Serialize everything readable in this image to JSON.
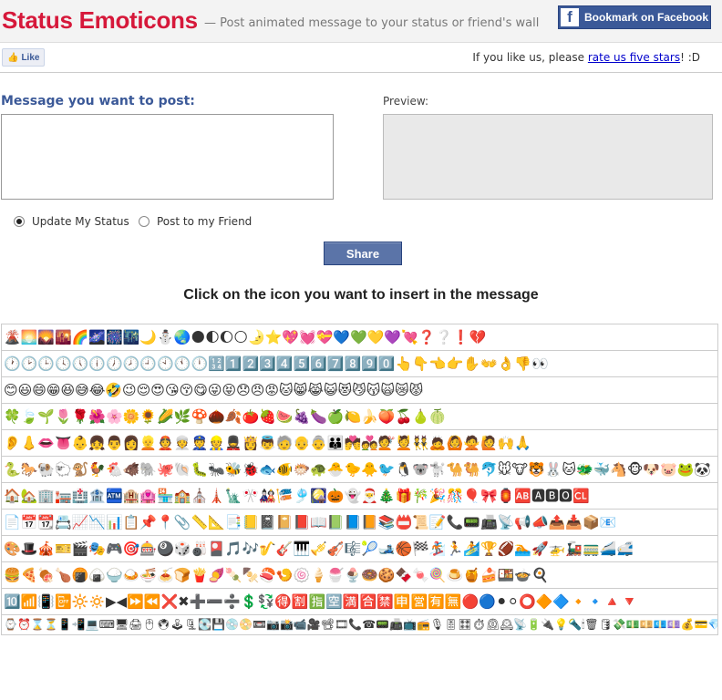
{
  "header": {
    "title": "Status Emoticons",
    "subtitle": "— Post animated message to your status or friend's wall",
    "bookmark_label": "Bookmark on Facebook",
    "fb_logo": "f"
  },
  "likebar": {
    "like_label": "Like",
    "like_icon": "👍",
    "rate_prefix": "If you like us, please ",
    "rate_link": "rate us five stars",
    "rate_suffix": "! :D"
  },
  "form": {
    "message_label": "Message you want to post:",
    "preview_label": "Preview:",
    "message_value": "",
    "option_update": "Update My Status",
    "option_friend": "Post to my Friend",
    "selected_option": "Update My Status",
    "share_label": "Share"
  },
  "instructions": "Click on the icon you want to insert in the message",
  "emoticon_rows": [
    "🌋🌅🌄🌇🌈🌌🎆🌃🌙⛄🌏🌑🌓🌔🌕🌛⭐💖💓💝💙💚💛💜💘❓❔❗💔",
    "🕐🕑🕒🕓🕔🕕🕖🕗🕘🕙🕚🕛🔢1️⃣2️⃣3️⃣4️⃣5️⃣6️⃣7️⃣8️⃣9️⃣0️⃣👆👇👈👉✋👐👌👎👀",
    "😊😃😄😁😆😅😂🤣😉😌😍😘😚😋😜😝😞😠😡🐱😸😹😺😻😼😽🙀😿😾",
    "🍀🍃🌱🌷🌹🌺🌸🌼🌻🌽🌿🍄🌰🍂🍅🍓🍉🍇🍆🍏🍋🍌🍑🍒🍐🍈",
    "👂👃👄👅👶👧👨👩👱👲👳👮👷💂👸👼🧓👴👵👪💏💑💇💆👯🙇🙆🙅🙋🙌🙏",
    "🐍🐎🐏🐑🐒🐓🐔🐗🐘🐙🐚🐛🐜🐝🐞🐟🐠🐡🐢🐣🐤🐥🐦🐧🐨🐩🐪🐫🐬🐭🐮🐯🐰🐱🐲🐳🐴🐵🐶🐷🐸🐼",
    "🏠🏡🏢🏣🏥🏦🏧🏨🏩🏪🏫⛪🗼🗽🎌🎎🎏🎐🎑🎃👻🎅🎄🎁🎋🎉🎊🎈🎀🏮🆎🅰🅱🅾🆑",
    "📄📅📆📇📈📉📊📋📌📍📎📏📐📑📒📓📔📕📖📗📘📙📚📛📜📝📞📟📠📡📢📣📤📥📦📧",
    "🎨🎩🎪🎫🎬🎭🎮🎯🎰🎱🎲🎳🎴🎵🎶🎷🎸🎹🎺🎻🎼🎾🎿🏀🏁🏂🏃🏄🏆🏈🏊🚀🚁🚂🚃🚄🚅",
    "🍔🍕🍖🍗🍘🍙🍚🍛🍜🍝🍞🍟🍠🍡🍢🍣🍤🍥🍦🍧🍨🍩🍪🍫🍬🍭🍮🍯🍰🍱🍲🍳",
    "🔟📶📳📴🔆🔅▶◀⏩⏪❌✖➕➖➗💲💱🉐🈹🈯🈳🈵🈴🈲🈸🈺🈶🈚🔴🔵⚫⚪⭕🔶🔷🔸🔹🔺🔻",
    "⌚⏰⌛⏳📱📲💻⌨🖥🖨🖱🖲🕹🗜💽💾💿📀📼📷📸📹🎥📽🎞📞☎📟📠📺📻🎙🎚🎛⏱⏲🕰📡🔋🔌💡🔦🕯🗑🛢💸💵💴💶💷💰💳💎⚖🔧🔨⚒🛠⛏🔩⚙⛓🔫💣🔪🗡⚔🛡🚬⚰⚱🏺🔮📿💈⚗🔭🔬🕳💊💉🌡🚽🚰🚿🛁🛀🛎🔑🗝🚪🛋🛏🛌🖼🛍🛒🎁🎈🎏🎀🎊🎉🎎🏮🎐✉📩📨📧💌📥📤📦🏷📪📫📬📭📮📯📜📃📄📑📊📈📉🗒🗓📆📅📇🗃🗳🗄📋📁📂🗂🗞📰📓📔📒📕📗📘📙📚📖🔖🔗📎🖇📐📏📌📍✂🖊🖋✒🖌🖍📝✏🔍🔎🔏🔐🔒🔓"
  ]
}
